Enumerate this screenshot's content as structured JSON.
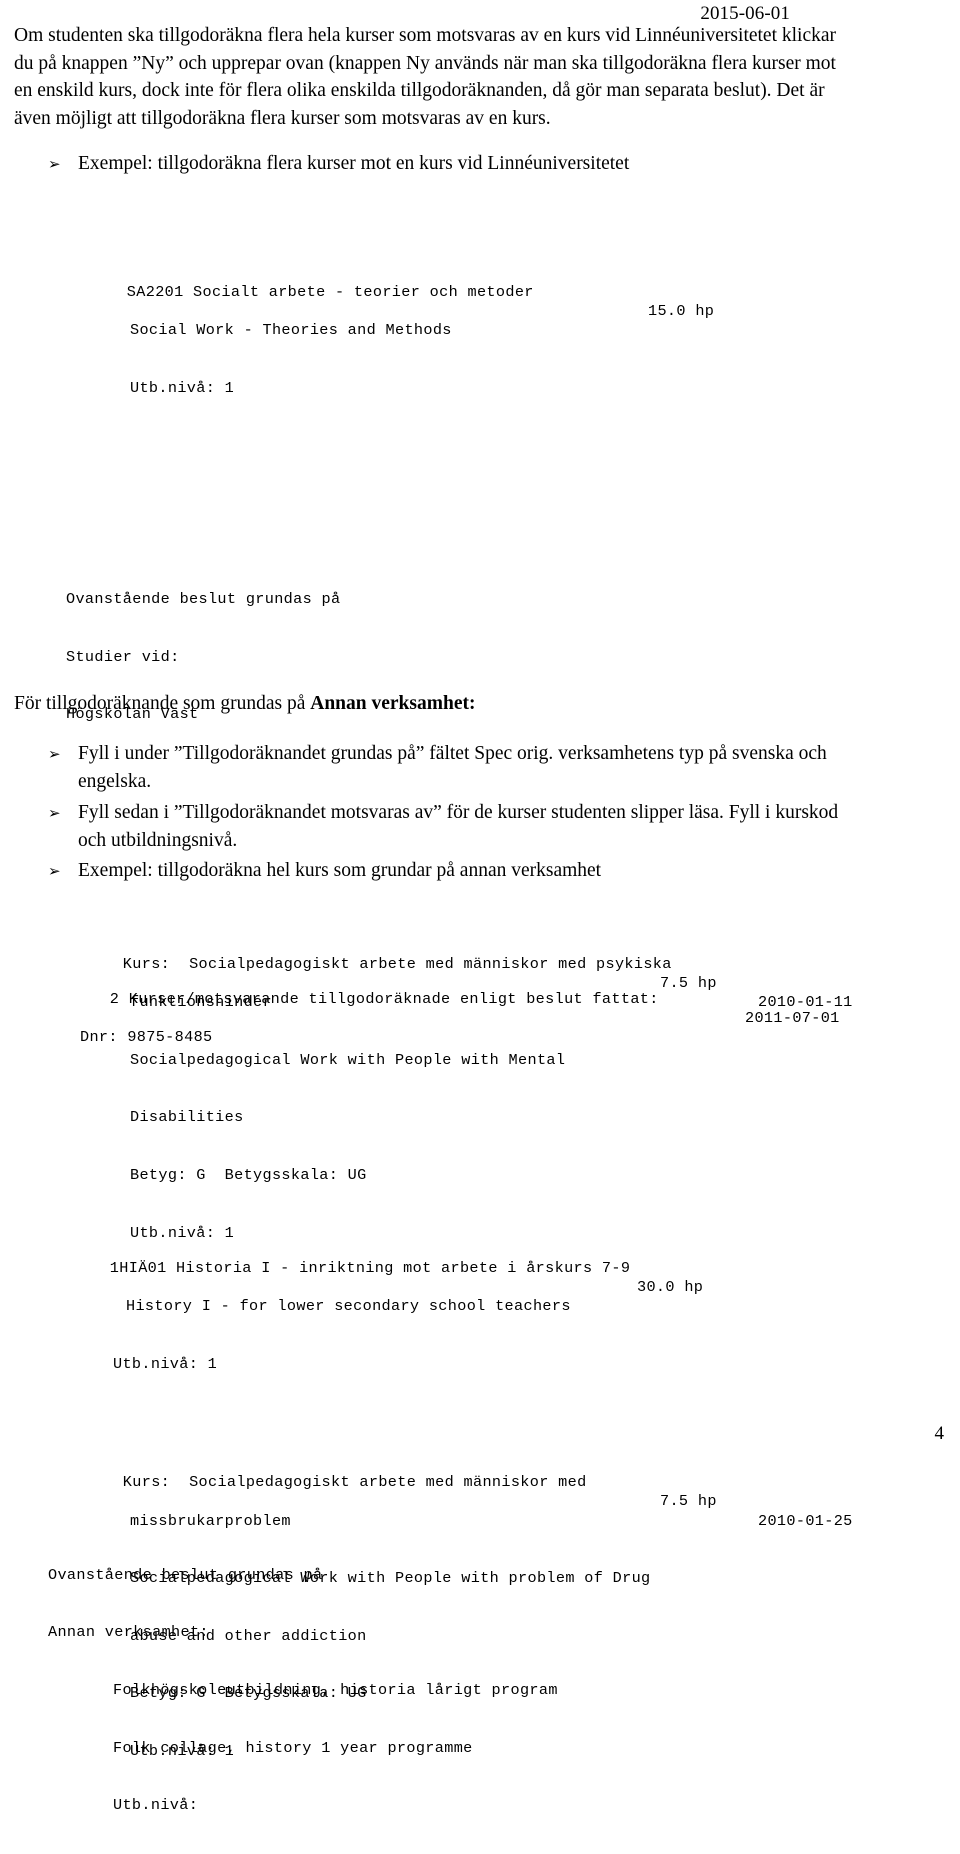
{
  "document": {
    "date": "2015-06-01",
    "page_number": "4"
  },
  "intro": {
    "lines": [
      "Om studenten ska tillgodoräkna flera hela kurser som motsvaras av en kurs vid Linnéuniversitetet klickar",
      "du på knappen ”Ny” och upprepar ovan (knappen Ny används när man ska tillgodoräkna flera kurser mot",
      "en enskild kurs, dock inte för flera olika enskilda tillgodoräknanden, då gör man separata beslut). Det är",
      "även möjligt att tillgodoräkna flera kurser som motsvaras av en kurs."
    ]
  },
  "bullets": {
    "marker": "➢",
    "example_linneuniversitetet": [
      "Exempel: tillgodoräkna flera kurser mot en kurs vid Linnéuniversitetet"
    ],
    "fill_spec_orig": [
      "Fyll i under ”Tillgodoräknandet grundas på” fältet Spec orig. verksamhetens typ på svenska och",
      "engelska."
    ],
    "fill_motsvaras_av": [
      "Fyll sedan i ”Tillgodoräknandet motsvaras av” för de kurser studenten slipper läsa. Fyll i kurskod",
      "och utbildningsnivå."
    ],
    "example_annan_verksamhet": [
      "Exempel: tillgodoräkna hel kurs som grundar på annan verksamhet"
    ]
  },
  "section_annan_verksamhet": {
    "prefix": "För tillgodoräknande som grundas på ",
    "bold": "Annan verksamhet:"
  },
  "report_one": {
    "course_header": {
      "code_and_name": "SA2201 Socialt arbete - teorier och metoder",
      "credits": "15.0 hp"
    },
    "name_en": "Social Work - Theories and Methods",
    "level": "Utb.nivå: 1",
    "basis_label": "Ovanstående beslut grundas på",
    "studies_label": "Studier vid:",
    "institution": "Högskolan Väst",
    "courses": [
      {
        "label": "Kurs:",
        "name_sv_line1": "Socialpedagogiskt arbete med människor med psykiska",
        "name_sv_line2": "funktionshinder",
        "name_en_line1": "Socialpedagogical Work with People with Mental",
        "name_en_line2": "Disabilities",
        "grade": "Betyg: G  Betygsskala: UG",
        "level": "Utb.nivå: 1",
        "credits": "7.5 hp",
        "date": "2010-01-11"
      },
      {
        "label": "Kurs:",
        "name_sv_line1": "Socialpedagogiskt arbete med människor med",
        "name_sv_line2": "missbrukarproblem",
        "name_en_line1": "Socialpedagogical Work with People with problem of Drug",
        "name_en_line2": "abuse and other addiction",
        "grade": "Betyg: G  Betygsskala: UG",
        "level": "Utb.nivå: 1",
        "credits": "7.5 hp",
        "date": "2010-01-25"
      }
    ]
  },
  "report_two": {
    "decision_header": "2 Kurser/motsvarande tillgodoräknade enligt beslut fattat:",
    "decision_date": "2011-07-01",
    "dnr": "Dnr: 9875-8485",
    "course_code_and_name": "1HIÄ01 Historia I - inriktning mot arbete i årskurs 7-9",
    "course_credits": "30.0 hp",
    "course_name_en": "History I - for lower secondary school teachers",
    "course_level": "Utb.nivå: 1",
    "basis_label": "Ovanstående beslut grundas på",
    "basis_type": "Annan verksamhet:",
    "activity_sv": "Folkhögskoleutbildning, historia lårigt program",
    "activity_en": "Folk collage, history 1 year programme",
    "activity_level": "Utb.nivå:"
  }
}
